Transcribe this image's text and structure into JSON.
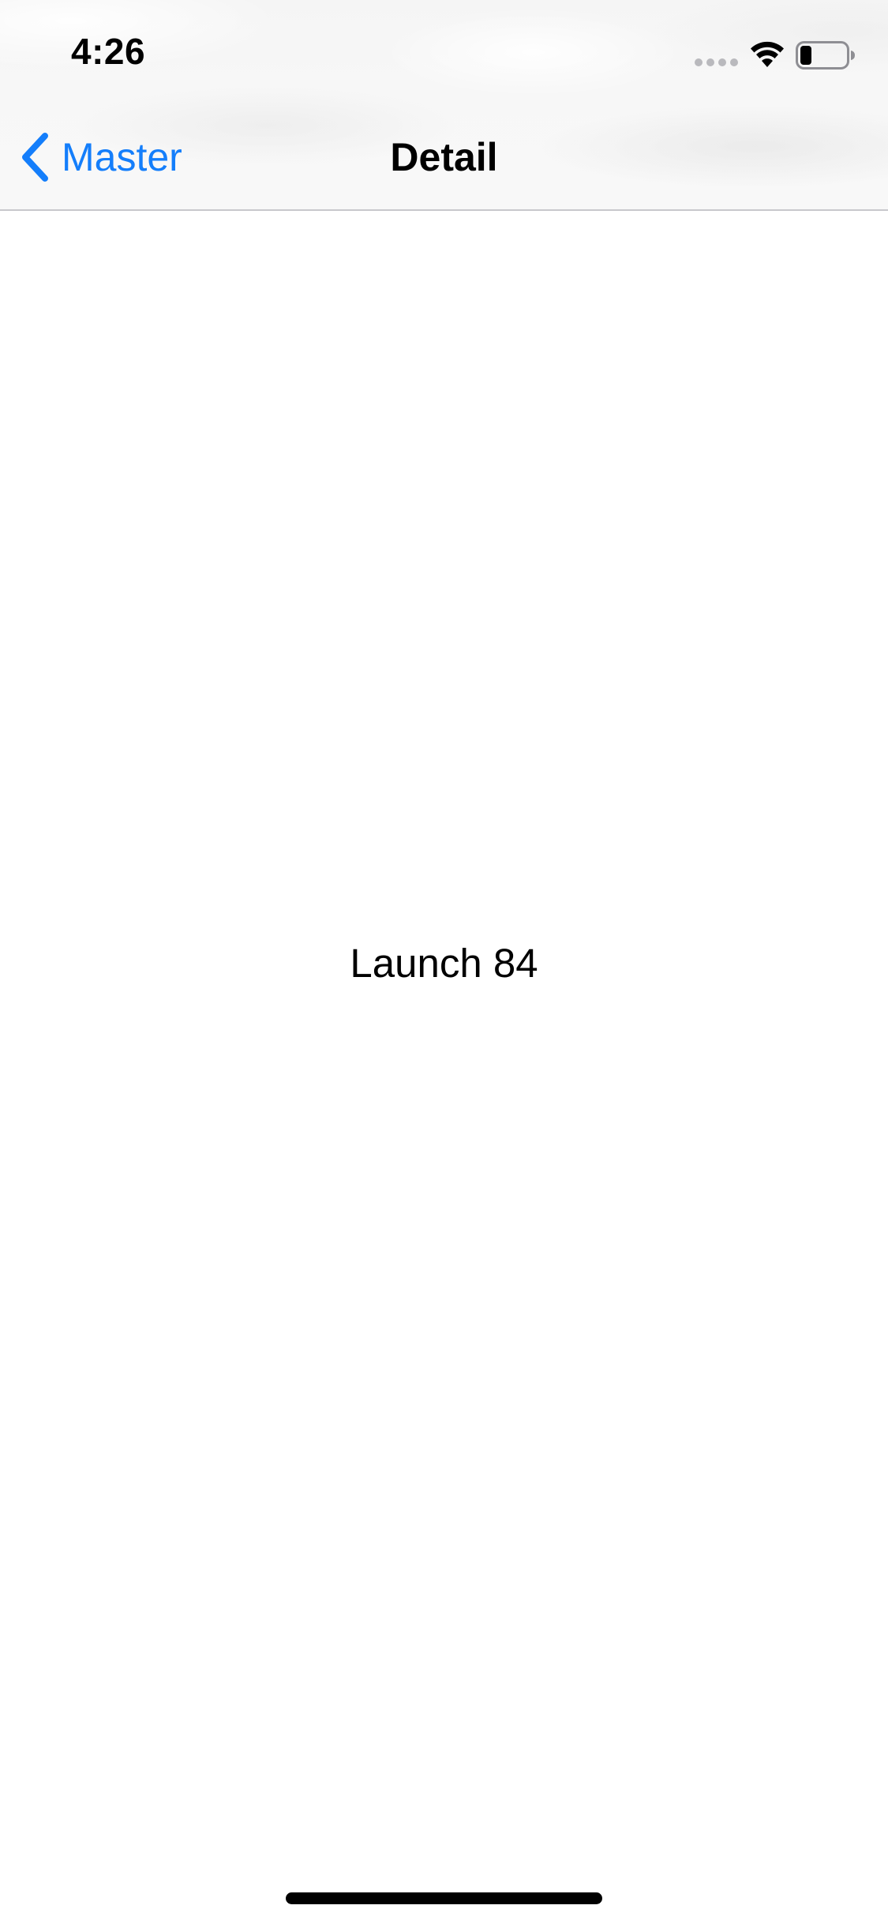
{
  "status_bar": {
    "time": "4:26",
    "icons": [
      "cellular-signal-icon",
      "wifi-icon",
      "battery-icon"
    ]
  },
  "nav_bar": {
    "back_label": "Master",
    "title": "Detail"
  },
  "content": {
    "detail_text": "Launch 84"
  },
  "colors": {
    "accent": "#147efb",
    "text": "#000000",
    "nav_background": "#f7f7f7",
    "separator": "#c8c8cc"
  }
}
